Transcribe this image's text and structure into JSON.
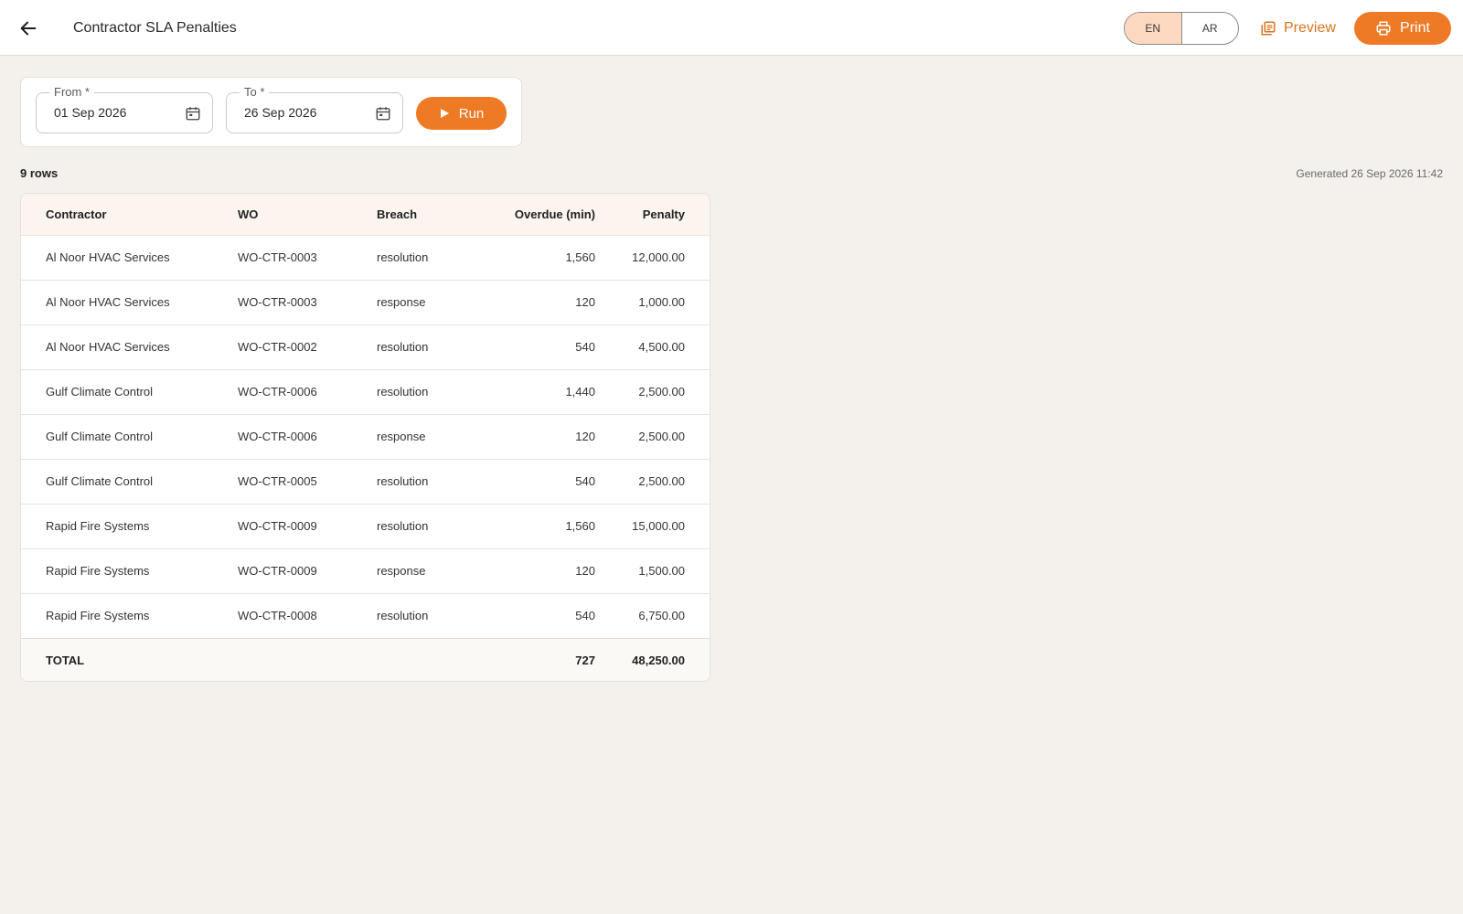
{
  "appbar": {
    "title": "Contractor SLA Penalties",
    "lang": [
      "EN",
      "AR"
    ],
    "active_lang": "EN",
    "preview_label": "Preview",
    "print_label": "Print"
  },
  "filters": {
    "from_label": "From *",
    "from_value": "01 Sep 2026",
    "to_label": "To *",
    "to_value": "26 Sep 2026",
    "run_label": "Run"
  },
  "summary": {
    "row_count": "9 rows",
    "generated": "Generated 26 Sep 2026 11:42"
  },
  "table": {
    "columns": [
      "Contractor",
      "WO",
      "Breach",
      "Overdue (min)",
      "Penalty"
    ],
    "rows": [
      [
        "Al Noor HVAC Services",
        "WO-CTR-0003",
        "resolution",
        "1,560",
        "12,000.00"
      ],
      [
        "Al Noor HVAC Services",
        "WO-CTR-0003",
        "response",
        "120",
        "1,000.00"
      ],
      [
        "Al Noor HVAC Services",
        "WO-CTR-0002",
        "resolution",
        "540",
        "4,500.00"
      ],
      [
        "Gulf Climate Control",
        "WO-CTR-0006",
        "resolution",
        "1,440",
        "2,500.00"
      ],
      [
        "Gulf Climate Control",
        "WO-CTR-0006",
        "response",
        "120",
        "2,500.00"
      ],
      [
        "Gulf Climate Control",
        "WO-CTR-0005",
        "resolution",
        "540",
        "2,500.00"
      ],
      [
        "Rapid Fire Systems",
        "WO-CTR-0009",
        "resolution",
        "1,560",
        "15,000.00"
      ],
      [
        "Rapid Fire Systems",
        "WO-CTR-0009",
        "response",
        "120",
        "1,500.00"
      ],
      [
        "Rapid Fire Systems",
        "WO-CTR-0008",
        "resolution",
        "540",
        "6,750.00"
      ]
    ],
    "total": {
      "label": "TOTAL",
      "overdue": "727",
      "penalty": "48,250.00"
    }
  },
  "colors": {
    "accent": "#ef7a26",
    "accent_text": "#d9741f",
    "active_lang_bg": "#fcd9c0",
    "background": "#f4f1ec"
  }
}
